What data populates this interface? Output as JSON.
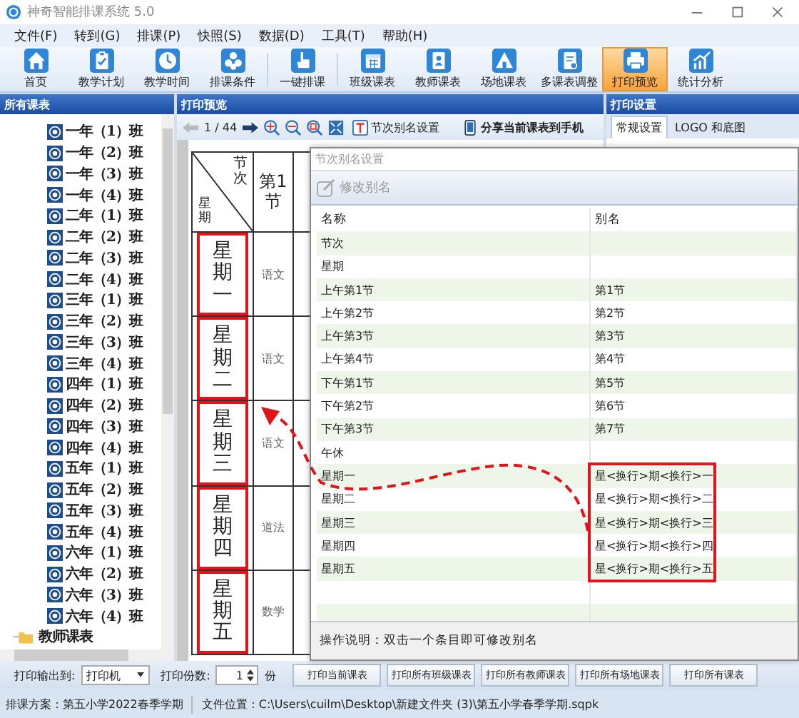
{
  "window": {
    "title": "神奇智能排课系统 5.0"
  },
  "menu": [
    "文件(F)",
    "转到(G)",
    "排课(P)",
    "快照(S)",
    "数据(D)",
    "工具(T)",
    "帮助(H)"
  ],
  "toolbar": [
    [
      {
        "label": "首页",
        "selected": false
      },
      {
        "label": "教学计划",
        "selected": false
      },
      {
        "label": "教学时间",
        "selected": false
      },
      {
        "label": "排课条件",
        "selected": false
      }
    ],
    [
      {
        "label": "一键排课",
        "selected": false
      }
    ],
    [
      {
        "label": "班级课表",
        "selected": false
      },
      {
        "label": "教师课表",
        "selected": false
      },
      {
        "label": "场地课表",
        "selected": false
      },
      {
        "label": "多课表调整",
        "selected": false
      },
      {
        "label": "打印预览",
        "selected": true
      },
      {
        "label": "统计分析",
        "selected": false
      }
    ]
  ],
  "left_panel": {
    "title": "所有课表",
    "classes": [
      "一年（1）班",
      "一年（2）班",
      "一年（3）班",
      "一年（4）班",
      "二年（1）班",
      "二年（2）班",
      "二年（3）班",
      "二年（4）班",
      "三年（1）班",
      "三年（2）班",
      "三年（3）班",
      "三年（4）班",
      "四年（1）班",
      "四年（2）班",
      "四年（3）班",
      "四年（4）班",
      "五年（1）班",
      "五年（2）班",
      "五年（3）班",
      "五年（4）班",
      "六年（1）班",
      "六年（2）班",
      "六年（3）班",
      "六年（4）班"
    ],
    "folder": "教师课表"
  },
  "preview": {
    "title": "打印预览",
    "page": "1 / 44",
    "alias_button": "节次别名设置",
    "share_button": "分享当前课表到手机",
    "corner_top": "节次",
    "corner_bottom": "星期",
    "periods": [
      "第1节"
    ],
    "days": [
      {
        "name": "星期一",
        "highlighted": true,
        "cells": [
          "语文"
        ]
      },
      {
        "name": "星期二",
        "highlighted": true,
        "cells": [
          "语文"
        ]
      },
      {
        "name": "星期三",
        "highlighted": true,
        "cells": [
          "语文"
        ]
      },
      {
        "name": "星期四",
        "highlighted": true,
        "cells": [
          "道法"
        ]
      },
      {
        "name": "星期五",
        "highlighted": true,
        "cells": [
          "数学"
        ]
      }
    ]
  },
  "settings": {
    "title": "打印设置",
    "tabs": [
      {
        "label": "常规设置",
        "selected": true
      },
      {
        "label": "LOGO 和底图",
        "selected": false
      }
    ]
  },
  "dialog": {
    "title": "节次别名设置",
    "edit_button": "修改别名",
    "columns": [
      "名称",
      "别名"
    ],
    "rows": [
      {
        "name": "节次",
        "highlighted": false
      },
      {
        "name": "星期",
        "highlighted": false
      },
      {
        "name": "上午第1节",
        "alias": "第1节",
        "highlighted": false
      },
      {
        "name": "上午第2节",
        "alias": "第2节",
        "highlighted": false
      },
      {
        "name": "上午第3节",
        "alias": "第3节",
        "highlighted": false
      },
      {
        "name": "上午第4节",
        "alias": "第4节",
        "highlighted": false
      },
      {
        "name": "下午第1节",
        "alias": "第5节",
        "highlighted": false
      },
      {
        "name": "下午第2节",
        "alias": "第6节",
        "highlighted": false
      },
      {
        "name": "下午第3节",
        "alias": "第7节",
        "highlighted": false
      },
      {
        "name": "午休",
        "highlighted": false
      },
      {
        "name": "星期一",
        "alias": "星<换行>期<换行>一",
        "highlighted": true
      },
      {
        "name": "星期二",
        "alias": "星<换行>期<换行>二",
        "highlighted": true
      },
      {
        "name": "星期三",
        "alias": "星<换行>期<换行>三",
        "highlighted": true
      },
      {
        "name": "星期四",
        "alias": "星<换行>期<换行>四",
        "highlighted": true
      },
      {
        "name": "星期五",
        "alias": "星<换行>期<换行>五",
        "highlighted": true
      }
    ],
    "note": "操作说明：双击一个条目即可修改别名"
  },
  "print_bar": {
    "output_label": "打印输出到:",
    "output": "打印机",
    "copies_label": "打印份数:",
    "copies": "1",
    "copies_unit": "份",
    "buttons": [
      "打印当前课表",
      "打印所有班级课表",
      "打印所有教师课表",
      "打印所有场地课表",
      "打印所有课表"
    ]
  },
  "status_bar": [
    "排课方案：第五小学2022春季学期",
    "文件位置：C:\\Users\\cuilm\\Desktop\\新建文件夹 (3)\\第五小学春季学期.sqpk"
  ]
}
